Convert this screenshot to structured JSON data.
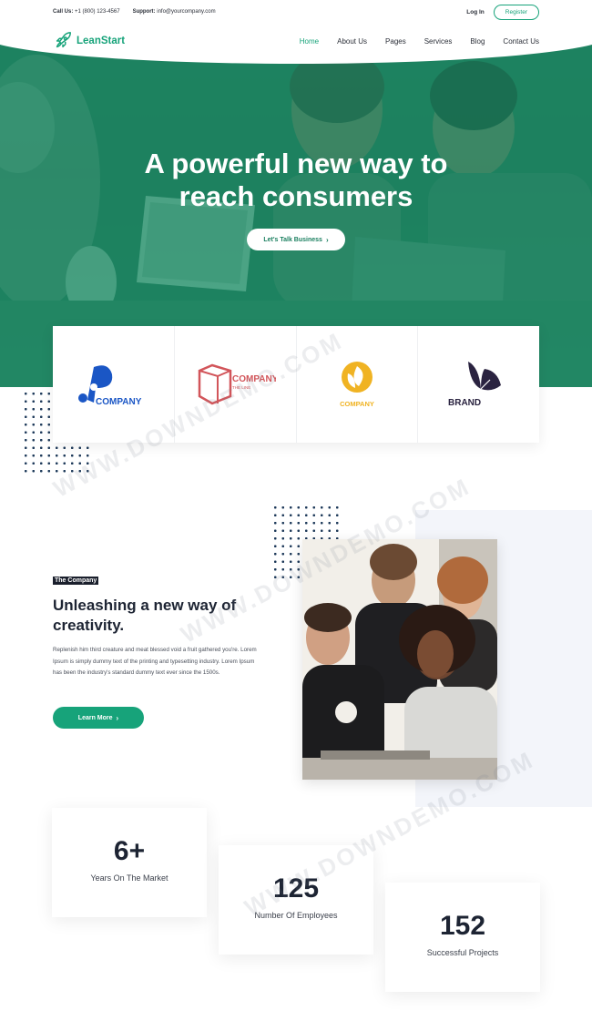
{
  "topbar": {
    "call_label": "Call Us:",
    "call_value": "+1 (800) 123-4567",
    "support_label": "Support:",
    "support_value": "info@yourcompany.com",
    "login": "Log In",
    "register": "Register"
  },
  "nav": {
    "logo_text": "LeanStart",
    "items": [
      "Home",
      "About Us",
      "Pages",
      "Services",
      "Blog",
      "Contact Us"
    ],
    "active": "Home"
  },
  "hero": {
    "title_line1": "A powerful new way to",
    "title_line2": "reach consumers",
    "cta": "Let's Talk Business",
    "cta_icon": "chevron-right-icon"
  },
  "logos": [
    {
      "name": "COMPANY",
      "icon": "ip-logo-icon",
      "color": "#1a56c5"
    },
    {
      "name": "COMPANY",
      "tagline": "THE LINE",
      "icon": "box-logo-icon",
      "color": "#d2555a"
    },
    {
      "name": "COMPANY",
      "icon": "swirl-logo-icon",
      "color": "#f0b323"
    },
    {
      "name": "BRAND",
      "icon": "leaf-logo-icon",
      "color": "#2a2340"
    }
  ],
  "about": {
    "badge": "The Company",
    "title": "Unleashing a new way of creativity.",
    "text": "Replenish him third creature and meat blessed void a fruit gathered you're. Lorem Ipsum is simply dummy text of the printing and typesetting industry. Lorem Ipsum has been the industry's standard dummy text ever since the 1500s.",
    "button": "Learn More"
  },
  "stats": [
    {
      "value": "6+",
      "label": "Years On The Market"
    },
    {
      "value": "125",
      "label": "Number Of Employees"
    },
    {
      "value": "152",
      "label": "Successful Projects"
    }
  ],
  "colors": {
    "accent": "#17a37a",
    "hero_green": "#1f8a66",
    "dark": "#1d2433"
  },
  "watermark": "WWW.DOWNDEMO.COM"
}
